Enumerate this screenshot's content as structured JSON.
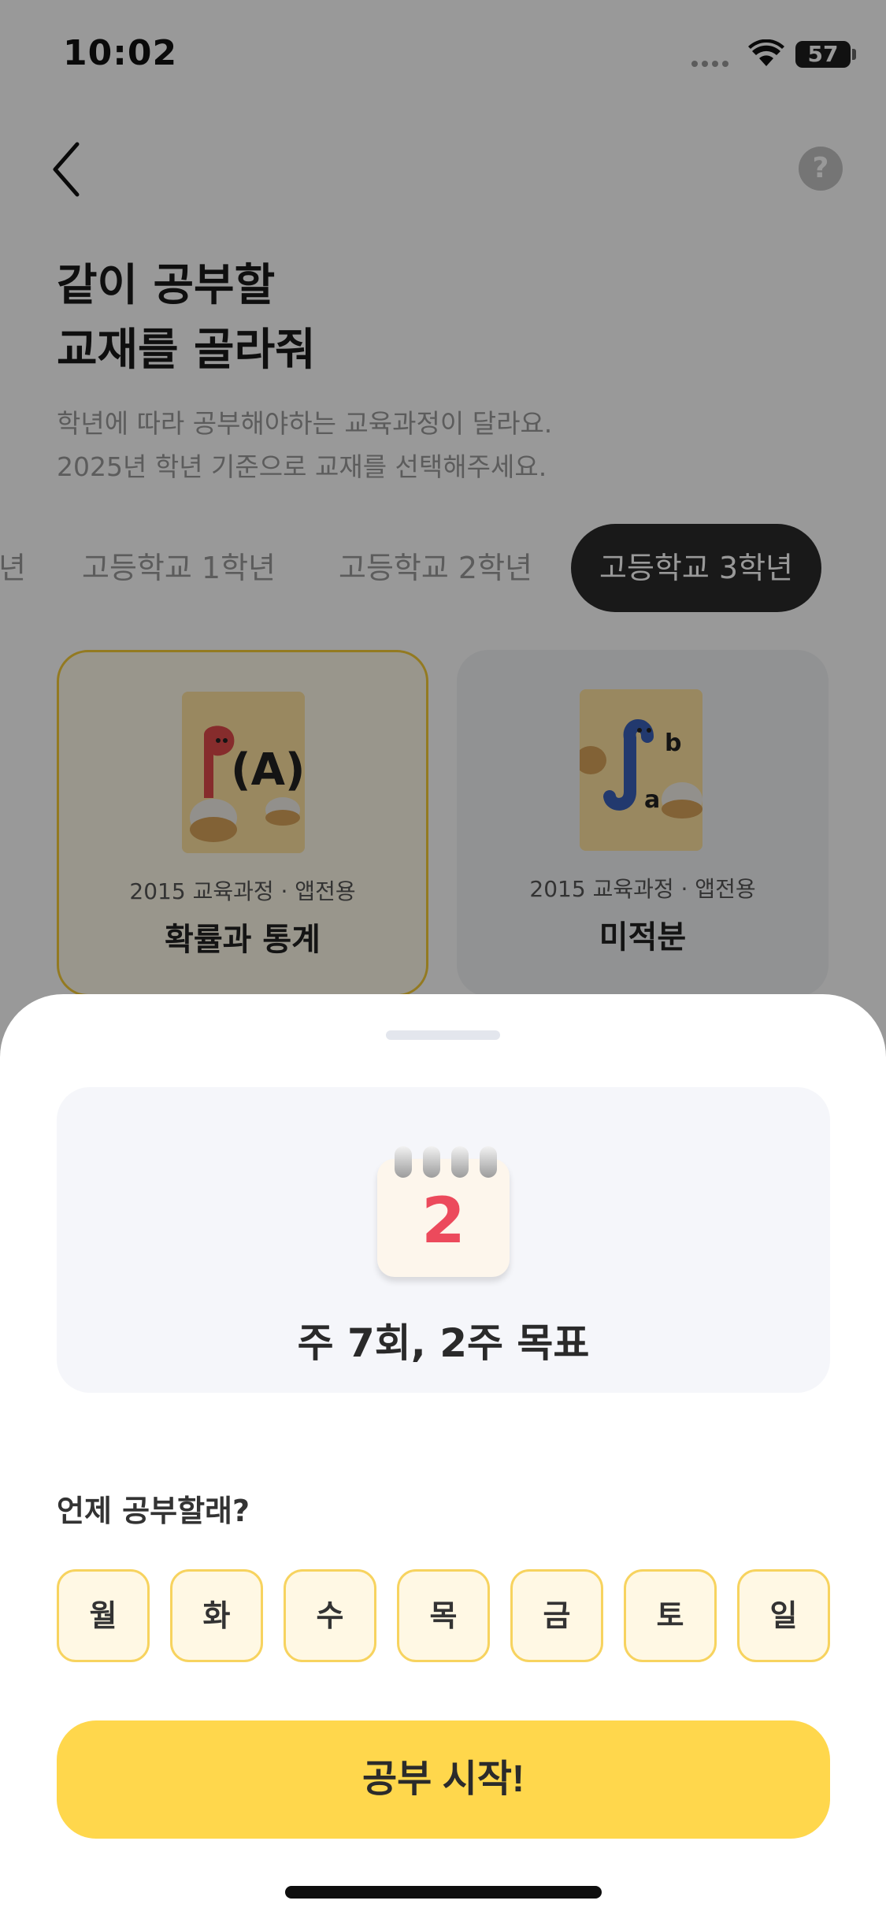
{
  "status_bar": {
    "time": "10:02",
    "battery": "57"
  },
  "header": {
    "help_label": "?"
  },
  "page": {
    "title_line1": "같이 공부할",
    "title_line2": "교재를 골라줘",
    "subtitle_line1": "학년에 따라 공부해야하는 교육과정이 달라요.",
    "subtitle_line2": "2025년 학년 기준으로 교재를 선택해주세요."
  },
  "grade_tabs": [
    {
      "label": "년"
    },
    {
      "label": "고등학교 1학년"
    },
    {
      "label": "고등학교 2학년"
    },
    {
      "label": "고등학교 3학년",
      "active": true
    }
  ],
  "books": [
    {
      "curriculum": "2015 교육과정 · 앱전용",
      "title": "확률과 통계",
      "selected": true
    },
    {
      "curriculum": "2015 교육과정 · 앱전용",
      "title": "미적분",
      "selected": false
    }
  ],
  "sheet": {
    "calendar_number": "2",
    "goal_text": "주 7회, 2주 목표",
    "days_label": "언제 공부할래?",
    "days": [
      "월",
      "화",
      "수",
      "목",
      "금",
      "토",
      "일"
    ],
    "start_button": "공부 시작!"
  },
  "colors": {
    "accent_yellow": "#ffd74c",
    "chip_border": "#f7d35f",
    "calendar_red": "#ec4a5c",
    "active_tab": "#2b2b2b"
  }
}
